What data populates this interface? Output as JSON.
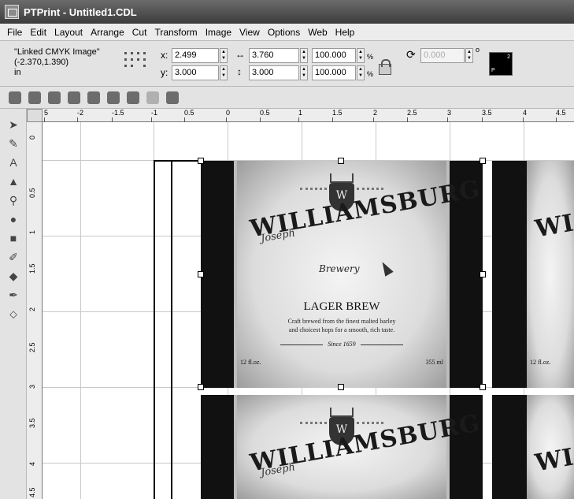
{
  "window": {
    "title": "PTPrint - Untitled1.CDL"
  },
  "menu": [
    "File",
    "Edit",
    "Layout",
    "Arrange",
    "Cut",
    "Transform",
    "Image",
    "View",
    "Options",
    "Web",
    "Help"
  ],
  "properties": {
    "object_type": "\"Linked CMYK Image\"",
    "object_position": "(-2.370,1.390)",
    "unit": "in",
    "x_label": "x:",
    "x_value": "2.499",
    "y_label": "y:",
    "y_value": "3.000",
    "width_value": "3.760",
    "height_value": "3.000",
    "scale_x": "100.000",
    "scale_y": "100.000",
    "pct": "%",
    "rotation_value": "0.000",
    "rotation_unit": "o",
    "swatch_top": "2",
    "swatch_bottom": "P"
  },
  "ruler": {
    "h_ticks": [
      "5",
      "-2",
      "-1.5",
      "-1",
      "0.5",
      "0",
      "0.5",
      "1",
      "1.5",
      "2",
      "2.5",
      "3",
      "3.5",
      "4",
      "4.5"
    ],
    "v_ticks": [
      "0",
      "0.5",
      "1",
      "1.5",
      "2",
      "2.5",
      "3",
      "3.5",
      "4",
      "4.5"
    ]
  },
  "label": {
    "script": "Joseph",
    "name": "WILLIAMSBURG",
    "brewery": "Brewery",
    "crest_letter": "W",
    "product": "LAGER BREW",
    "desc_line1": "Craft brewed from the finest malted barley",
    "desc_line2": "and choicest hops for a smooth, rich taste.",
    "since": "Since 1659",
    "volume_oz": "12 fl.oz.",
    "volume_ml": "355 ml"
  },
  "colors": {
    "titlebar": "#4a4a4a",
    "canvas": "#ffffff",
    "label_dark": "#111111"
  }
}
